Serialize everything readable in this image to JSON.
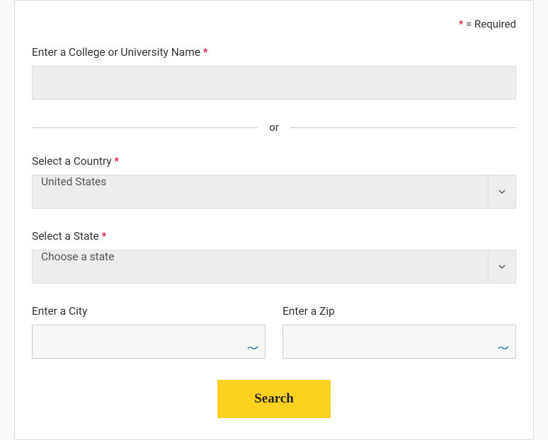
{
  "required_note": "= Required",
  "asterisk": "*",
  "fields": {
    "college_label": "Enter a College or University Name",
    "college_value": "",
    "divider": "or",
    "country_label": "Select a Country",
    "country_value": "United States",
    "state_label": "Select a State",
    "state_value": "Choose a state",
    "city_label": "Enter a City",
    "city_value": "",
    "zip_label": "Enter a Zip",
    "zip_value": ""
  },
  "search_button": "Search"
}
